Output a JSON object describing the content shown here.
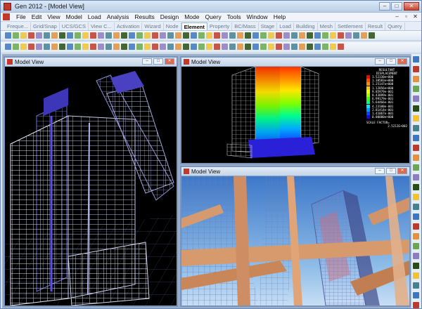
{
  "window": {
    "title": "Gen 2012 - [Model View]"
  },
  "menu": [
    "File",
    "Edit",
    "View",
    "Model",
    "Load",
    "Analysis",
    "Results",
    "Design",
    "Mode",
    "Query",
    "Tools",
    "Window",
    "Help"
  ],
  "tabs": [
    "Freque...",
    "Grid/Snap",
    "UCS/GCS",
    "View C...",
    "Activation",
    "Wizard",
    "Node",
    "Element",
    "Property",
    "BC/Mass",
    "Stage",
    "Load",
    "Building",
    "Mesh",
    "Settlement",
    "Result",
    "Query"
  ],
  "active_tab": "Element",
  "views": [
    {
      "title": "Model View"
    },
    {
      "title": "Model View"
    },
    {
      "title": "Model View"
    }
  ],
  "legend": {
    "heading1": "RESULTANT",
    "heading2": "DISPLACEMENT",
    "values": [
      "1.52330e+000",
      "1.38583e+000",
      "1.25147e+000",
      "1.12056e+000",
      "9.85979e-001",
      "8.43899e-001",
      "6.99179e-001",
      "5.64466e-001",
      "4.23100e-001",
      "2.81414e-001",
      "1.41067e-001",
      "0.00000e+000"
    ],
    "colors": [
      "#ff0000",
      "#ff4a00",
      "#ff8c00",
      "#ffc800",
      "#f2ff00",
      "#a4ff00",
      "#3cff00",
      "#00ff78",
      "#00e0ff",
      "#0096ff",
      "#0046ff",
      "#1800ff"
    ],
    "footer1": "SCALE FACTOR=",
    "footer2": "2.5212E+002"
  },
  "toolbar_colors": [
    "#3a78c2",
    "#6aa84f",
    "#f1c232",
    "#c0392b",
    "#8e7cc3",
    "#45818e",
    "#e69138",
    "#274e13"
  ]
}
